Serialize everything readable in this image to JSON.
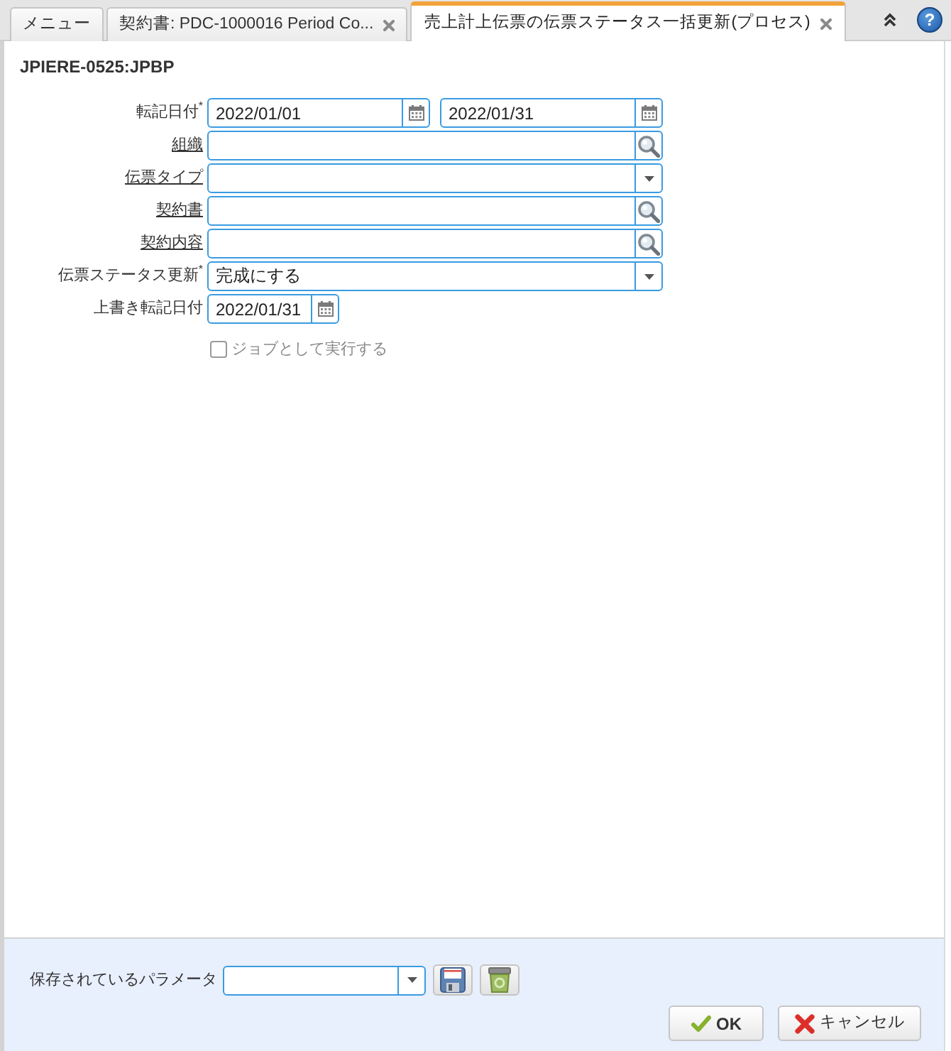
{
  "tabs": [
    {
      "label": "メニュー",
      "selected": false,
      "closable": false
    },
    {
      "label": "契約書: PDC-1000016 Period Co...",
      "selected": false,
      "closable": true
    },
    {
      "label": "売上計上伝票の伝票ステータス一括更新(プロセス)",
      "selected": true,
      "closable": true
    }
  ],
  "help_button": {
    "label": "?"
  },
  "process": {
    "title": "JPIERE-0525:JPBP"
  },
  "fields": [
    {
      "label": "転記日付$^{*}$",
      "kind": "date_range",
      "link": false,
      "values": [
        "2022/01/01",
        "2022/01/31"
      ]
    },
    {
      "label": "組織",
      "kind": "search",
      "link": true
    },
    {
      "label": "伝票タイプ",
      "kind": "select",
      "link": true
    },
    {
      "label": "契約書",
      "kind": "search",
      "link": true
    },
    {
      "label": "契約内容",
      "kind": "search",
      "link": true
    },
    {
      "label": "伝票ステータス更新$^{*}$",
      "kind": "select",
      "link": false,
      "value": "完成にする"
    },
    {
      "label": "上書き転記日付",
      "kind": "date",
      "link": false,
      "value": "2022/01/31"
    }
  ],
  "run_as_job": {
    "label": "ジョブとして実行する",
    "checked": false,
    "disabled": true
  },
  "saved_parameters": {
    "label": "保存されているパラメータ"
  },
  "buttons": [
    {
      "label": "OK",
      "kind": "ok"
    },
    {
      "label": "キャンセル",
      "kind": "cancel"
    }
  ]
}
